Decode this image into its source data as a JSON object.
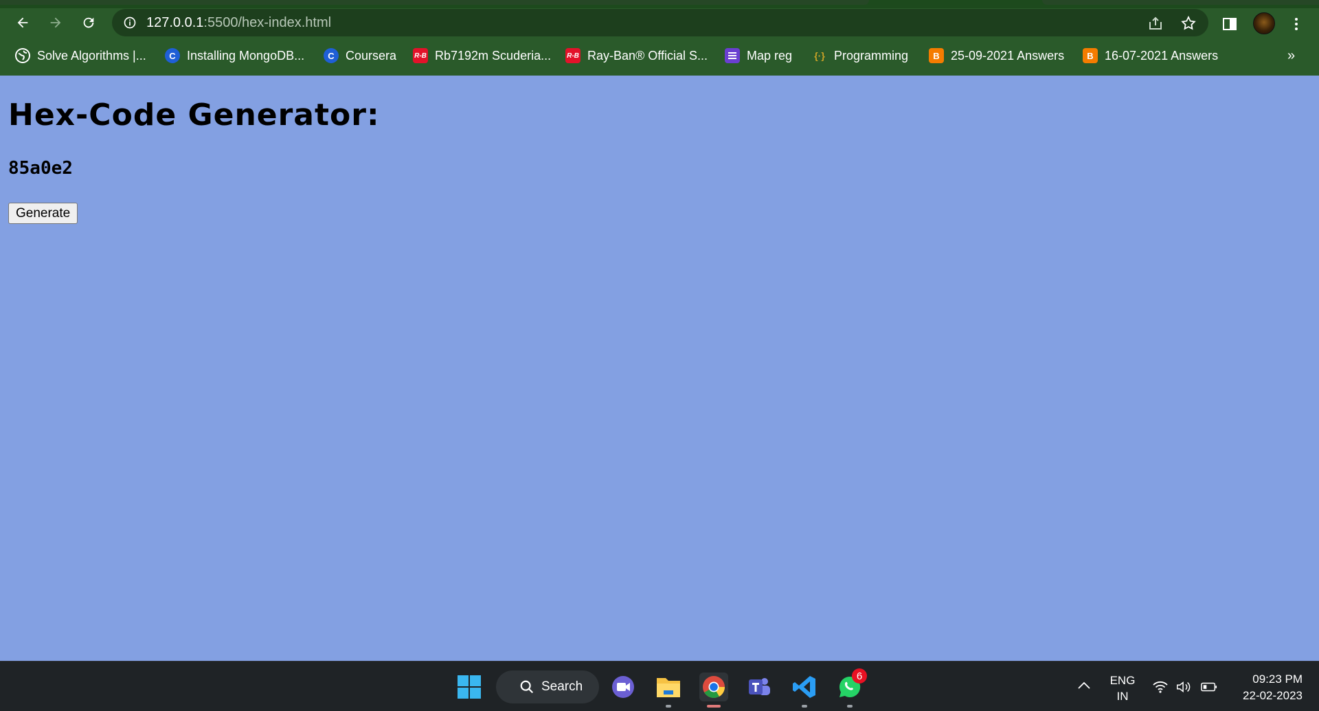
{
  "browser": {
    "url_host": "127.0.0.1",
    "url_path": ":5500/hex-index.html",
    "bookmarks": [
      {
        "label": "Solve Algorithms |...",
        "icon": "globe-icon"
      },
      {
        "label": "Installing MongoDB...",
        "icon": "coursera-icon"
      },
      {
        "label": "Coursera",
        "icon": "coursera-icon"
      },
      {
        "label": "Rb7192m Scuderia...",
        "icon": "rayban-icon"
      },
      {
        "label": "Ray-Ban® Official S...",
        "icon": "rayban-icon"
      },
      {
        "label": "Map reg",
        "icon": "list-icon"
      },
      {
        "label": "Programming",
        "icon": "code-braces-icon"
      },
      {
        "label": "25-09-2021 Answers",
        "icon": "blogger-icon"
      },
      {
        "label": "16-07-2021 Answers",
        "icon": "blogger-icon"
      }
    ],
    "bookmarks_overflow": "»",
    "theme_color": "#2a5a2a"
  },
  "page": {
    "title": "Hex-Code Generator:",
    "hex_value": "85a0e2",
    "generate_label": "Generate",
    "background_color": "#83a0e2"
  },
  "taskbar": {
    "search_label": "Search",
    "whatsapp_badge": "6",
    "lang_line1": "ENG",
    "lang_line2": "IN",
    "time": "09:23 PM",
    "date": "22-02-2023"
  }
}
